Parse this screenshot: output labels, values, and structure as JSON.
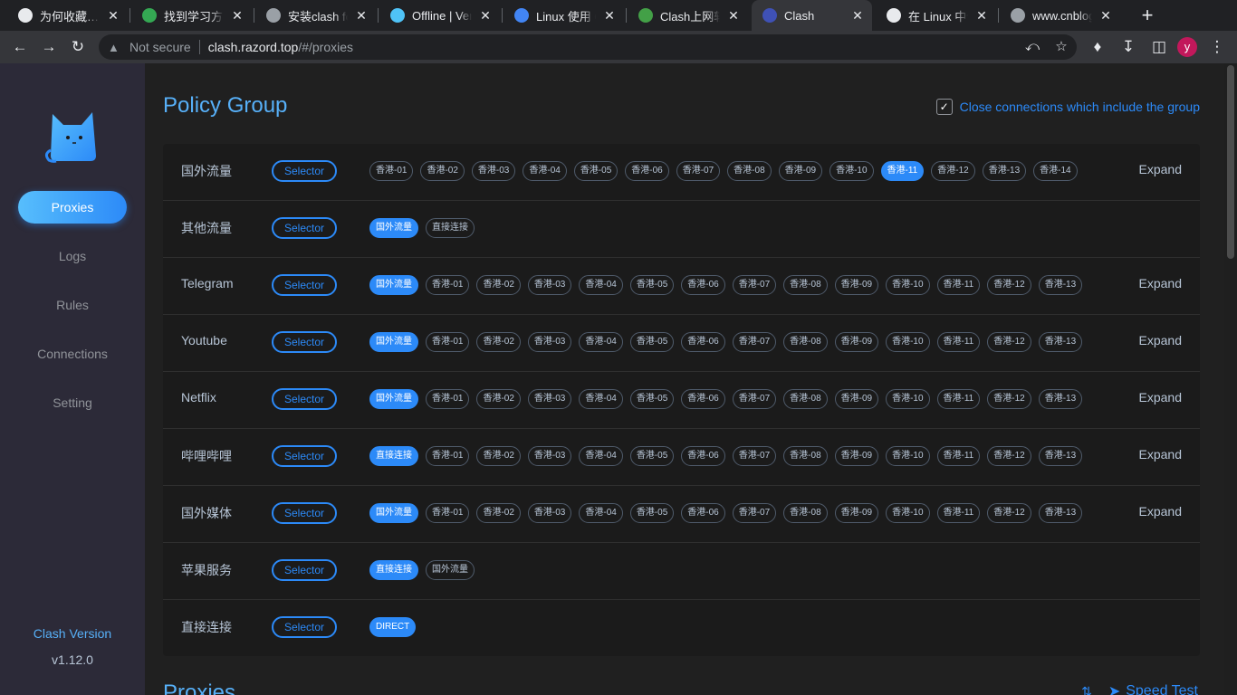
{
  "tabs": [
    {
      "title": "为何收藏…",
      "icon": "globe-icon",
      "color": "#e8eaed",
      "active": false
    },
    {
      "title": "找到学习方向",
      "icon": "q-icon",
      "color": "#34a853",
      "active": false
    },
    {
      "title": "安装clash fo",
      "icon": "cnblogs-icon",
      "color": "#9aa0a6",
      "active": false
    },
    {
      "title": "Offline | Vercel",
      "icon": "bird-icon",
      "color": "#4fc3f7",
      "active": false
    },
    {
      "title": "Linux 使用 C",
      "icon": "layers-icon",
      "color": "#4285f4",
      "active": false
    },
    {
      "title": "Clash上网软件",
      "icon": "m-icon",
      "color": "#43a047",
      "active": false
    },
    {
      "title": "Clash",
      "icon": "cat-icon",
      "color": "#3f51b5",
      "active": true
    },
    {
      "title": "在 Linux 中使",
      "icon": "rocket-icon",
      "color": "#e8eaed",
      "active": false
    },
    {
      "title": "www.cnblogs",
      "icon": "cnblogs-icon",
      "color": "#9aa0a6",
      "active": false
    }
  ],
  "omnibox": {
    "security": "Not secure",
    "host": "clash.razord.top",
    "path": "/#/proxies"
  },
  "avatar_letter": "y",
  "sidebar": {
    "nav": [
      "Proxies",
      "Logs",
      "Rules",
      "Connections",
      "Setting"
    ],
    "active": "Proxies",
    "version_label": "Clash Version",
    "version": "v1.12.0"
  },
  "main": {
    "title": "Policy Group",
    "close_connections": "Close connections which include the group",
    "close_connections_checked": true,
    "second_title": "Proxies",
    "speed_test": "Speed Test",
    "selector_label": "Selector",
    "expand_label": "Expand"
  },
  "groups": [
    {
      "name": "国外流量",
      "type": "Selector",
      "expand": true,
      "selected": "香港-11",
      "proxies": [
        "香港-01",
        "香港-02",
        "香港-03",
        "香港-04",
        "香港-05",
        "香港-06",
        "香港-07",
        "香港-08",
        "香港-09",
        "香港-10",
        "香港-11",
        "香港-12",
        "香港-13",
        "香港-14"
      ]
    },
    {
      "name": "其他流量",
      "type": "Selector",
      "expand": false,
      "selected": "国外流量",
      "proxies": [
        "国外流量",
        "直接连接"
      ]
    },
    {
      "name": "Telegram",
      "type": "Selector",
      "expand": true,
      "selected": "国外流量",
      "proxies": [
        "国外流量",
        "香港-01",
        "香港-02",
        "香港-03",
        "香港-04",
        "香港-05",
        "香港-06",
        "香港-07",
        "香港-08",
        "香港-09",
        "香港-10",
        "香港-11",
        "香港-12",
        "香港-13"
      ]
    },
    {
      "name": "Youtube",
      "type": "Selector",
      "expand": true,
      "selected": "国外流量",
      "proxies": [
        "国外流量",
        "香港-01",
        "香港-02",
        "香港-03",
        "香港-04",
        "香港-05",
        "香港-06",
        "香港-07",
        "香港-08",
        "香港-09",
        "香港-10",
        "香港-11",
        "香港-12",
        "香港-13"
      ]
    },
    {
      "name": "Netflix",
      "type": "Selector",
      "expand": true,
      "selected": "国外流量",
      "proxies": [
        "国外流量",
        "香港-01",
        "香港-02",
        "香港-03",
        "香港-04",
        "香港-05",
        "香港-06",
        "香港-07",
        "香港-08",
        "香港-09",
        "香港-10",
        "香港-11",
        "香港-12",
        "香港-13"
      ]
    },
    {
      "name": "哔哩哔哩",
      "type": "Selector",
      "expand": true,
      "selected": "直接连接",
      "proxies": [
        "直接连接",
        "香港-01",
        "香港-02",
        "香港-03",
        "香港-04",
        "香港-05",
        "香港-06",
        "香港-07",
        "香港-08",
        "香港-09",
        "香港-10",
        "香港-11",
        "香港-12",
        "香港-13"
      ]
    },
    {
      "name": "国外媒体",
      "type": "Selector",
      "expand": true,
      "selected": "国外流量",
      "proxies": [
        "国外流量",
        "香港-01",
        "香港-02",
        "香港-03",
        "香港-04",
        "香港-05",
        "香港-06",
        "香港-07",
        "香港-08",
        "香港-09",
        "香港-10",
        "香港-11",
        "香港-12",
        "香港-13"
      ]
    },
    {
      "name": "苹果服务",
      "type": "Selector",
      "expand": false,
      "selected": "直接连接",
      "proxies": [
        "直接连接",
        "国外流量"
      ]
    },
    {
      "name": "直接连接",
      "type": "Selector",
      "expand": false,
      "selected": "DIRECT",
      "proxies": [
        "DIRECT"
      ]
    }
  ],
  "colors": {
    "accent": "#2c8af8",
    "heading": "#57b0f8",
    "sidebar_bg": "#2c2a38",
    "card_bg": "#1b1b1b"
  }
}
